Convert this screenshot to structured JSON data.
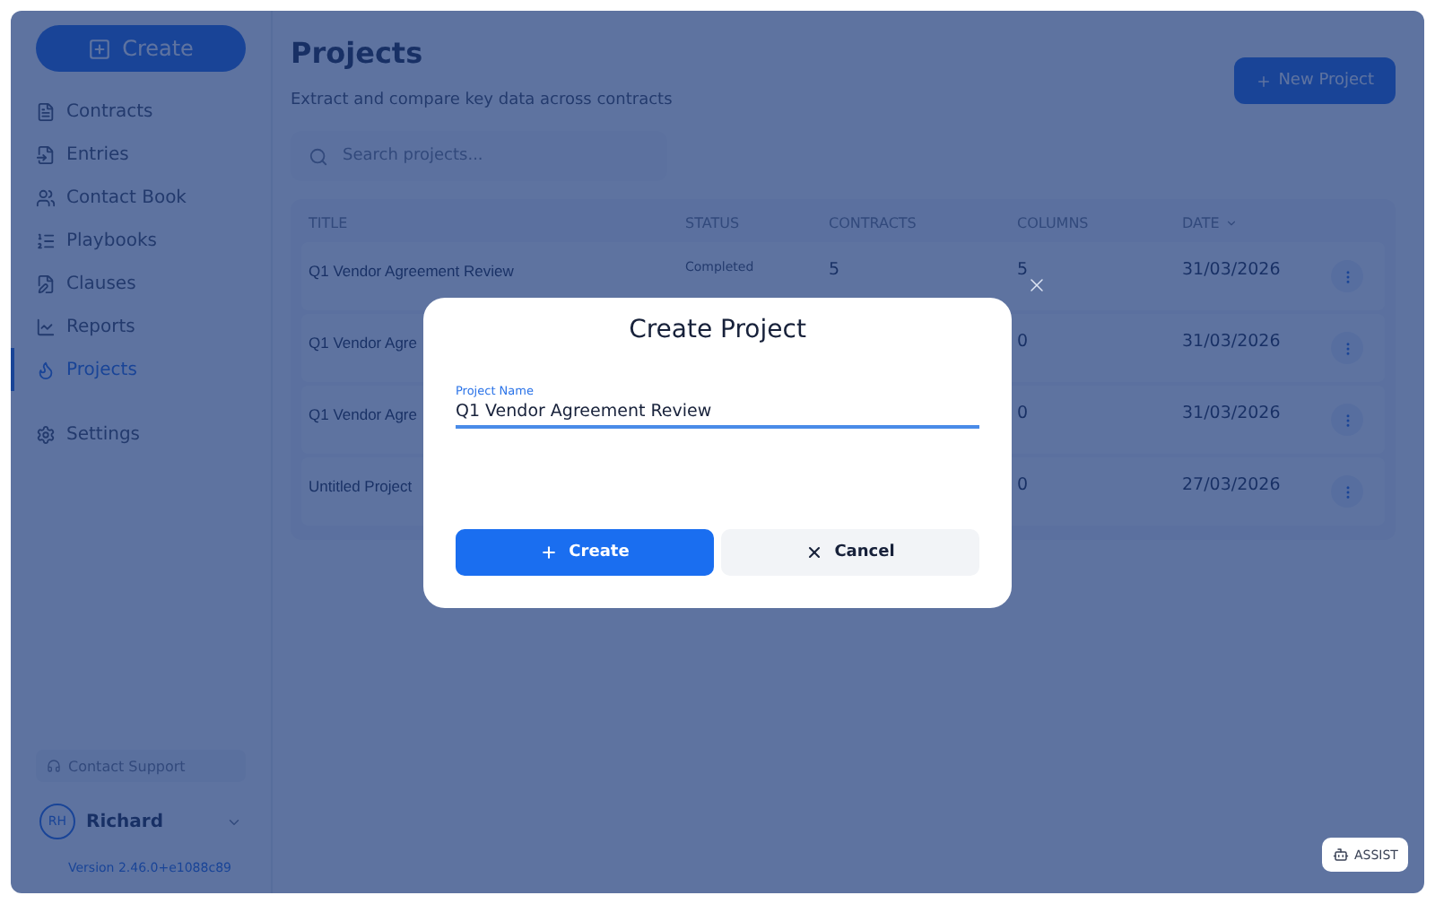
{
  "sidebar": {
    "create_button": "Create",
    "items": [
      {
        "label": "Contracts",
        "selected": false
      },
      {
        "label": "Entries",
        "selected": false
      },
      {
        "label": "Contact Book",
        "selected": false
      },
      {
        "label": "Playbooks",
        "selected": false
      },
      {
        "label": "Clauses",
        "selected": false
      },
      {
        "label": "Reports",
        "selected": false
      },
      {
        "label": "Projects",
        "selected": true
      }
    ],
    "settings": "Settings",
    "support": "Contact Support",
    "user": {
      "initials": "RH",
      "name": "Richard"
    },
    "version": "Version 2.46.0+e1088c89"
  },
  "page": {
    "title": "Projects",
    "subtitle": "Extract and compare key data across contracts",
    "new_button": "New Project",
    "search": {
      "placeholder": "Search projects..."
    }
  },
  "table": {
    "columns": [
      "TITLE",
      "STATUS",
      "CONTRACTS",
      "COLUMNS",
      "DATE"
    ],
    "rows": [
      {
        "title": "Q1 Vendor Agreement Review",
        "status": "Completed",
        "contracts": "5",
        "columns": "5",
        "date": "31/03/2026"
      },
      {
        "title": "Q1 Vendor Agre",
        "columns": "0",
        "date": "31/03/2026"
      },
      {
        "title": "Q1 Vendor Agre",
        "columns": "0",
        "date": "31/03/2026"
      },
      {
        "title": "Untitled Project",
        "columns": "0",
        "date": "27/03/2026"
      }
    ]
  },
  "dialog": {
    "title": "Create Project",
    "field": {
      "label": "Project Name",
      "value": "Q1 Vendor Agreement Review"
    },
    "buttons": [
      {
        "label": "Create",
        "kind": "primary"
      },
      {
        "label": "Cancel",
        "kind": "secondary"
      }
    ]
  },
  "assist_button": "ASSIST"
}
